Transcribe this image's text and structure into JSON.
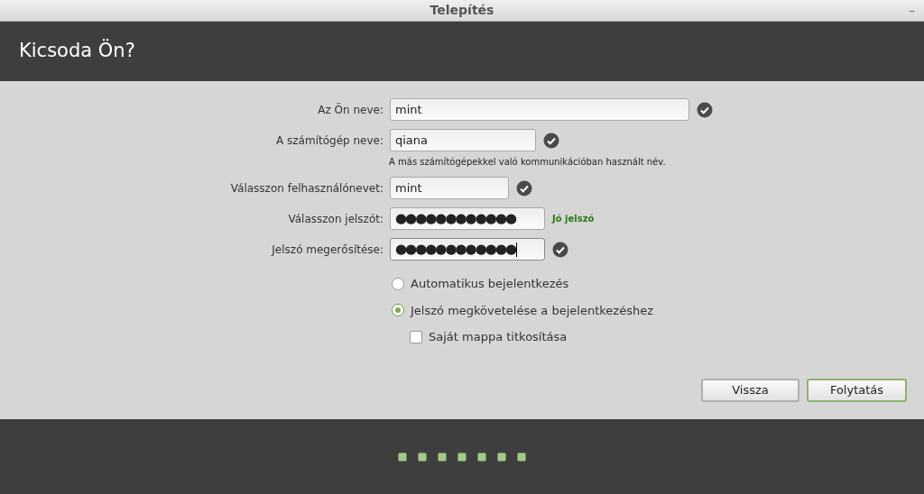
{
  "window": {
    "title": "Telepítés",
    "minimize": "–"
  },
  "header": {
    "title": "Kicsoda Ön?"
  },
  "fields": [
    {
      "label": "Az Ön neve:",
      "value": "mint",
      "kind": "text",
      "valid": true,
      "focused": false
    },
    {
      "label": "A számítógép neve:",
      "value": "qiana",
      "kind": "text",
      "valid": true,
      "focused": false,
      "hint": "A más számítógépekkel való kommunikációban használt név."
    },
    {
      "label": "Válasszon felhasználónevet:",
      "value": "mint",
      "kind": "text",
      "valid": true,
      "focused": false
    },
    {
      "label": "Válasszon jelszót:",
      "value": "●●●●●●●●●●●●",
      "kind": "password",
      "valid": false,
      "focused": false,
      "strength": "Jó jelszó"
    },
    {
      "label": "Jelszó megerősítése:",
      "value": "●●●●●●●●●●●●",
      "kind": "password",
      "valid": true,
      "focused": true
    }
  ],
  "login_options": [
    {
      "label": "Automatikus bejelentkezés",
      "selected": false
    },
    {
      "label": "Jelszó megkövetelése a bejelentkezéshez",
      "selected": true
    }
  ],
  "encrypt": {
    "label": "Saját mappa titkosítása",
    "checked": false
  },
  "buttons": [
    {
      "label": "Vissza",
      "default": false
    },
    {
      "label": "Folytatás",
      "default": true
    }
  ],
  "steps": [
    {
      "done": true
    },
    {
      "done": true
    },
    {
      "done": true
    },
    {
      "done": true
    },
    {
      "done": true
    },
    {
      "done": true
    },
    {
      "done": true
    }
  ]
}
